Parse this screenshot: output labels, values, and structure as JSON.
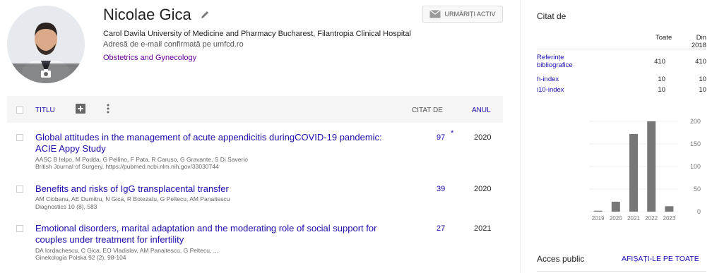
{
  "profile": {
    "name": "Nicolae Gica",
    "affiliation": "Carol Davila University of Medicine and Pharmacy Bucharest, Filantropia Clinical Hospital",
    "email": "Adresă de e-mail confirmată pe umfcd.ro",
    "interest": "Obstetrics and Gynecology",
    "follow_label": "URMĂRIȚI ACTIV"
  },
  "table": {
    "header": {
      "title": "TITLU",
      "cited": "CITAT DE",
      "year": "ANUL"
    },
    "rows": [
      {
        "title": "Global attitudes in the management of acute appendicitis duringCOVID-19 pandemic: ACIE Appy Study",
        "authors": "AASC B Ielpo, M Podda, G Pellino, F Pata, R Caruso, G Gravante, S Di Saverio",
        "venue": "British Journal of Surgery, https://pubmed.ncbi.nlm.nih.gov/33030744",
        "cited": "97",
        "star": "*",
        "year": "2020"
      },
      {
        "title": "Benefits and risks of IgG transplacental transfer",
        "authors": "AM Ciobanu, AE Dumitru, N Gica, R Botezatu, G Peltecu, AM Panaitescu",
        "venue": "Diagnostics 10 (8), 583",
        "cited": "39",
        "year": "2020"
      },
      {
        "title": "Emotional disorders, marital adaptation and the moderating role of social support for couples under treatment for infertility",
        "authors": "DA Iordachescu, C Gica, EO Vladislav, AM Panaitescu, G Peltecu, ...",
        "venue": "Ginekologia Polska 92 (2), 98-104",
        "cited": "27",
        "year": "2021"
      }
    ]
  },
  "sidebar": {
    "title": "Citat de",
    "col_all": "Toate",
    "col_since": "Din 2018",
    "metrics": [
      {
        "label": "Referințe bibliografice",
        "all": "410",
        "since": "410"
      },
      {
        "label": "h-index",
        "all": "10",
        "since": "10"
      },
      {
        "label": "i10-index",
        "all": "10",
        "since": "10"
      }
    ],
    "access_label": "Acces public",
    "show_all": "AFIȘAȚI-LE PE TOATE"
  },
  "chart_data": {
    "type": "bar",
    "categories": [
      "2019",
      "2020",
      "2021",
      "2022",
      "2023"
    ],
    "values": [
      2,
      22,
      172,
      200,
      12
    ],
    "ylim": [
      0,
      200
    ],
    "yticks": [
      "0",
      "50",
      "100",
      "150",
      "200"
    ],
    "title": "",
    "xlabel": "",
    "ylabel": "",
    "bar_color": "#777777"
  }
}
